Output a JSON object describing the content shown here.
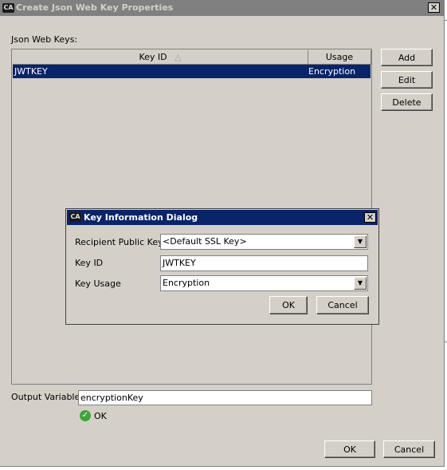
{
  "window": {
    "title": "Create Json Web Key Properties",
    "close_glyph": "✕",
    "app_icon_text": "CA"
  },
  "json_web_keys": {
    "label": "Json Web Keys:",
    "columns": [
      "Key ID",
      "Usage"
    ],
    "sort_indicator": "△",
    "rows": [
      {
        "key_id": "JWTKEY",
        "usage": "Encryption"
      }
    ]
  },
  "side_buttons": {
    "add": "Add",
    "edit": "Edit",
    "delete": "Delete"
  },
  "dialog": {
    "title": "Key Information Dialog",
    "close_glyph": "✕",
    "app_icon_text": "CA",
    "recipient_public_key_label": "Recipient Public Key",
    "recipient_public_key_value": "<Default SSL Key>",
    "key_id_label": "Key ID",
    "key_id_value": "JWTKEY",
    "key_usage_label": "Key Usage",
    "key_usage_value": "Encryption",
    "ok": "OK",
    "cancel": "Cancel",
    "dropdown_glyph": "▼"
  },
  "output": {
    "label": "Output Variable",
    "value": "encryptionKey",
    "status_text": "OK",
    "status_glyph": "✓"
  },
  "footer": {
    "ok": "OK",
    "cancel": "Cancel"
  }
}
